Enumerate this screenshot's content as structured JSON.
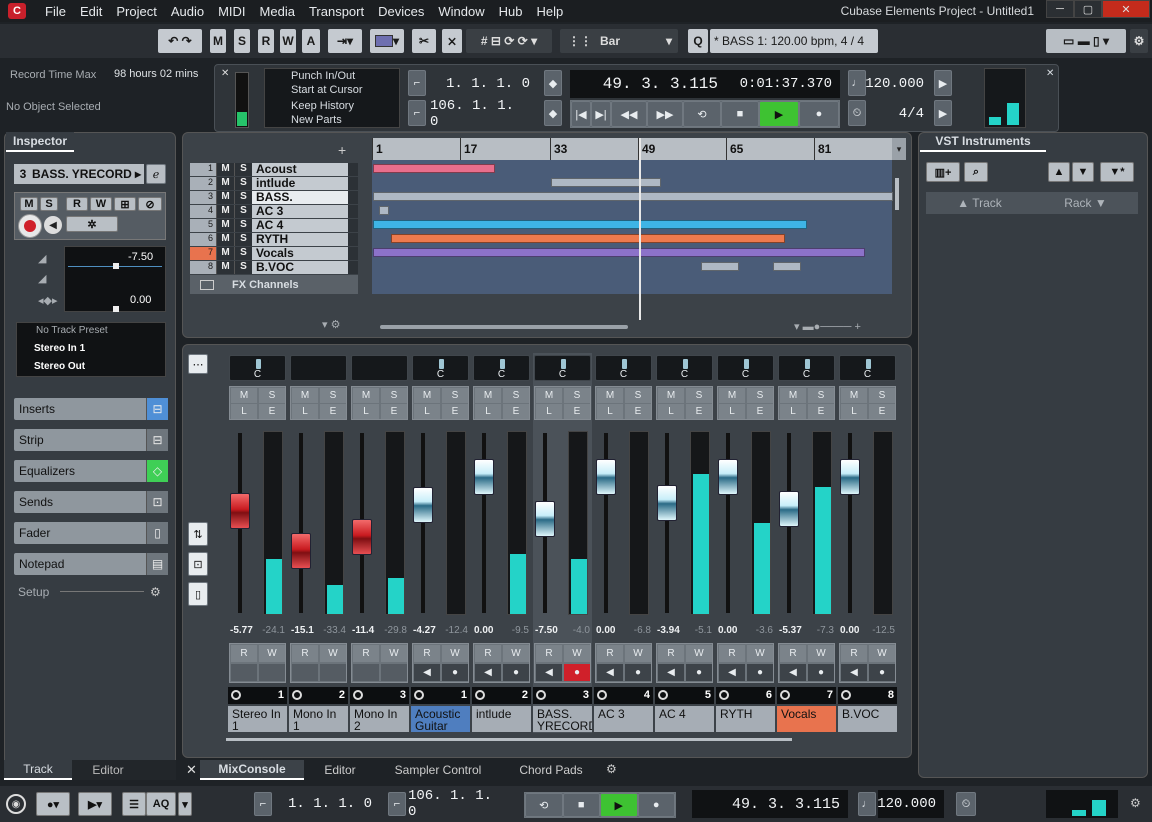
{
  "menu": {
    "items": [
      "File",
      "Edit",
      "Project",
      "Audio",
      "MIDI",
      "Media",
      "Transport",
      "Devices",
      "Window",
      "Hub",
      "Help"
    ],
    "title": "Cubase Elements Project - Untitled1"
  },
  "toolbar": {
    "ms": [
      "M",
      "S",
      "R",
      "W",
      "A"
    ],
    "snap": "Bar",
    "info": "* BASS 1: 120.00 bpm, 4 / 4"
  },
  "status": {
    "rtm_label": "Record Time Max",
    "rtm_value": "98 hours 02 mins",
    "no_object": "No Object Selected"
  },
  "transport_top": {
    "punch": "Punch In/Out",
    "start_cursor": "Start at Cursor",
    "keep_history": "Keep History",
    "new_parts": "New Parts",
    "left_loc": "1. 1. 1.    0",
    "right_loc": "106. 1. 1.    0",
    "position": "49.  3.  3.115",
    "time": "0:01:37.370",
    "tempo": "120.000",
    "signature": "4/4"
  },
  "inspector": {
    "tab": "Inspector",
    "track_num": "3",
    "track_name": "BASS. YRECORD",
    "vol": "-7.50",
    "pan": "0.00",
    "preset": "No Track Preset",
    "input": "Stereo In 1",
    "output": "Stereo Out",
    "sections": [
      "Inserts",
      "Strip",
      "Equalizers",
      "Sends",
      "Fader",
      "Notepad"
    ],
    "setup": "Setup"
  },
  "tracks": [
    {
      "num": "1",
      "name": "Acoust"
    },
    {
      "num": "2",
      "name": "intlude"
    },
    {
      "num": "3",
      "name": "BASS."
    },
    {
      "num": "4",
      "name": "AC 3"
    },
    {
      "num": "5",
      "name": "AC 4"
    },
    {
      "num": "6",
      "name": "RYTH"
    },
    {
      "num": "7",
      "name": "Vocals"
    },
    {
      "num": "8",
      "name": "B.VOC"
    }
  ],
  "fx_channels": "FX Channels",
  "ruler": [
    "1",
    "17",
    "33",
    "49",
    "65",
    "81"
  ],
  "vst": {
    "title": "VST Instruments",
    "track": "Track",
    "rack": "Rack"
  },
  "mixer": {
    "channels": [
      {
        "num": "1",
        "name": "Stereo In 1",
        "v1": "-5.77",
        "v2": "-24.1",
        "fader": "red",
        "level": 0.3,
        "knob": "C",
        "color": "#a6adb5",
        "input": true
      },
      {
        "num": "2",
        "name": "Mono In 1",
        "v1": "-15.1",
        "v2": "-33.4",
        "fader": "red",
        "level": 0.16,
        "knob": "",
        "color": "#a6adb5",
        "input": true
      },
      {
        "num": "3",
        "name": "Mono In 2",
        "v1": "-11.4",
        "v2": "-29.8",
        "fader": "red",
        "level": 0.2,
        "knob": "",
        "color": "#a6adb5",
        "input": true
      },
      {
        "num": "1",
        "name": "Acoustic Guitar",
        "v1": "-4.27",
        "v2": "-12.4",
        "fader": "blue",
        "level": 0,
        "knob": "C",
        "color": "#4f7ebf"
      },
      {
        "num": "2",
        "name": "intlude",
        "v1": "0.00",
        "v2": "-9.5",
        "fader": "blue",
        "level": 0.33,
        "knob": "C",
        "color": "#a6adb5"
      },
      {
        "num": "3",
        "name": "BASS. YRECORD",
        "v1": "-7.50",
        "v2": "-4.0",
        "fader": "blue",
        "level": 0.3,
        "knob": "C",
        "color": "#a6adb5",
        "rec": true
      },
      {
        "num": "4",
        "name": "AC 3",
        "v1": "0.00",
        "v2": "-6.8",
        "fader": "blue",
        "level": 0,
        "knob": "C",
        "color": "#a6adb5"
      },
      {
        "num": "5",
        "name": "AC 4",
        "v1": "-3.94",
        "v2": "-5.1",
        "fader": "blue",
        "level": 0.77,
        "knob": "C",
        "color": "#a6adb5"
      },
      {
        "num": "6",
        "name": "RYTH",
        "v1": "0.00",
        "v2": "-3.6",
        "fader": "blue",
        "level": 0.5,
        "knob": "C",
        "color": "#a6adb5"
      },
      {
        "num": "7",
        "name": "Vocals",
        "v1": "-5.37",
        "v2": "-7.3",
        "fader": "blue",
        "level": 0.7,
        "knob": "C",
        "color": "#e8734e"
      },
      {
        "num": "8",
        "name": "B.VOC",
        "v1": "0.00",
        "v2": "-12.5",
        "fader": "blue",
        "level": 0,
        "knob": "C",
        "color": "#a6adb5"
      }
    ]
  },
  "tabs_bottom": {
    "track": "Track",
    "editor": "Editor",
    "mixconsole": "MixConsole",
    "editor2": "Editor",
    "sampler": "Sampler Control",
    "chord": "Chord Pads"
  },
  "transport_bottom": {
    "left_loc": "1.  1.  1.    0",
    "right_loc": "106.  1.  1.    0",
    "position": "49.  3.  3.115",
    "tempo": "120.000",
    "aq": "AQ"
  }
}
